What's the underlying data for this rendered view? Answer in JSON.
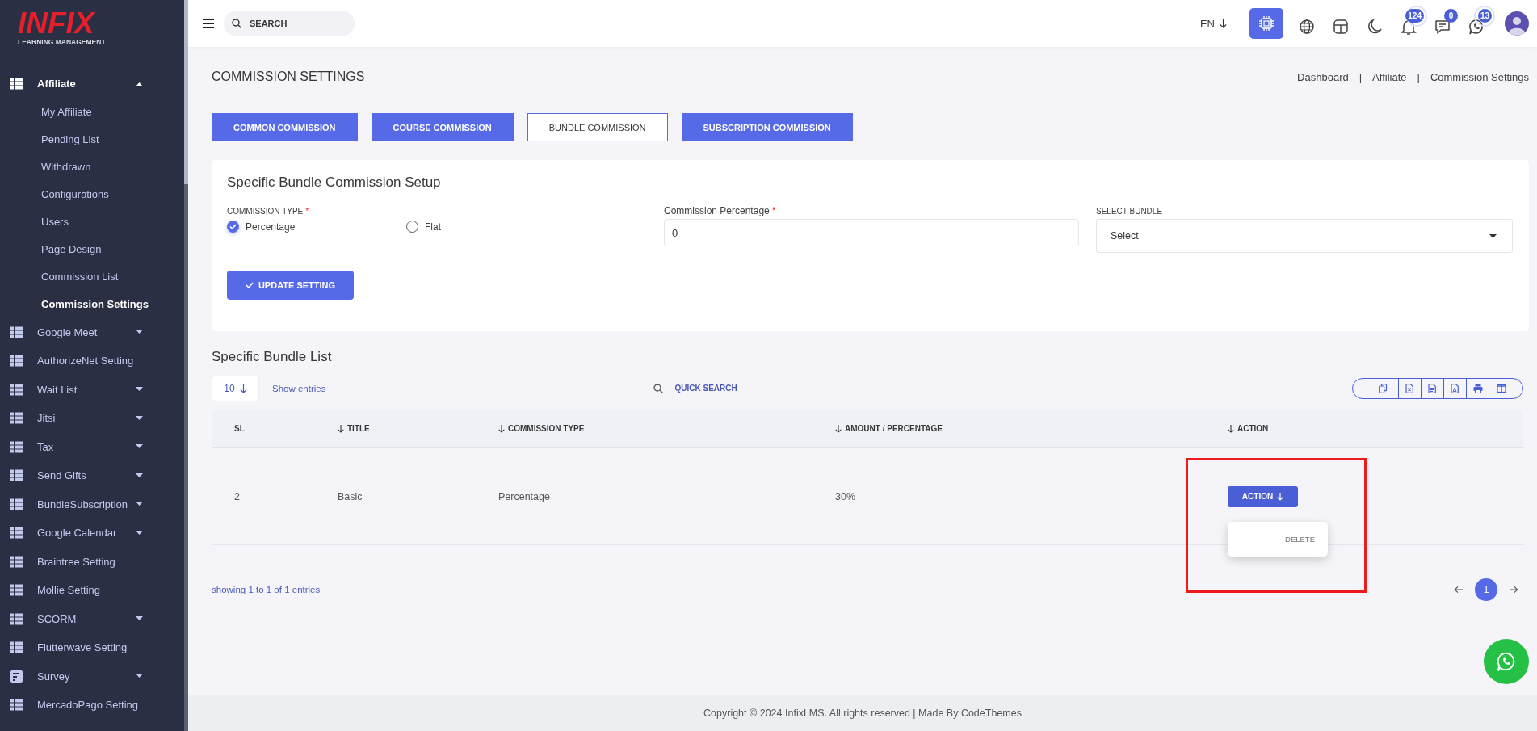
{
  "sidebar": {
    "logo": {
      "title": "INFIX",
      "subtitle": "LEARNING MANAGEMENT"
    },
    "items": [
      {
        "label": "Affiliate",
        "kind": "grid",
        "expandable": true,
        "expanded": true,
        "children": [
          {
            "label": "My Affiliate",
            "selected": false
          },
          {
            "label": "Pending List",
            "selected": false
          },
          {
            "label": "Withdrawn",
            "selected": false
          },
          {
            "label": "Configurations",
            "selected": false
          },
          {
            "label": "Users",
            "selected": false
          },
          {
            "label": "Page Design",
            "selected": false
          },
          {
            "label": "Commission List",
            "selected": false
          },
          {
            "label": "Commission Settings",
            "selected": true
          }
        ]
      },
      {
        "label": "Google Meet",
        "kind": "grid",
        "expandable": true,
        "expanded": false
      },
      {
        "label": "AuthorizeNet Setting",
        "kind": "grid",
        "expandable": false,
        "expanded": false
      },
      {
        "label": "Wait List",
        "kind": "grid",
        "expandable": true,
        "expanded": false
      },
      {
        "label": "Jitsi",
        "kind": "grid",
        "expandable": true,
        "expanded": false
      },
      {
        "label": "Tax",
        "kind": "grid",
        "expandable": true,
        "expanded": false
      },
      {
        "label": "Send Gifts",
        "kind": "grid",
        "expandable": true,
        "expanded": false
      },
      {
        "label": "BundleSubscription",
        "kind": "grid",
        "expandable": true,
        "expanded": false
      },
      {
        "label": "Google Calendar",
        "kind": "grid",
        "expandable": true,
        "expanded": false
      },
      {
        "label": "Braintree Setting",
        "kind": "grid",
        "expandable": false,
        "expanded": false
      },
      {
        "label": "Mollie Setting",
        "kind": "grid",
        "expandable": false,
        "expanded": false
      },
      {
        "label": "SCORM",
        "kind": "grid",
        "expandable": true,
        "expanded": false
      },
      {
        "label": "Flutterwave Setting",
        "kind": "grid",
        "expandable": false,
        "expanded": false
      },
      {
        "label": "Survey",
        "kind": "survey",
        "expandable": true,
        "expanded": false
      },
      {
        "label": "MercadoPago Setting",
        "kind": "grid",
        "expandable": false,
        "expanded": false
      }
    ]
  },
  "topbar": {
    "search": {
      "placeholder": "SEARCH"
    },
    "language": "EN",
    "actions": [
      {
        "kind": "chip",
        "highlighted": true
      },
      {
        "kind": "globe",
        "highlighted": false
      },
      {
        "kind": "layout",
        "highlighted": false
      },
      {
        "kind": "moon",
        "highlighted": false
      },
      {
        "kind": "bell",
        "highlighted": false,
        "badge": "124",
        "pulse": true
      },
      {
        "kind": "chat",
        "highlighted": false,
        "badge": "0",
        "pulse": false
      },
      {
        "kind": "phone-chat",
        "highlighted": false,
        "badge": "13",
        "pulse": true
      }
    ]
  },
  "page": {
    "title": "COMMISSION SETTINGS",
    "breadcrumb": [
      "Dashboard",
      "Affiliate",
      "Commission Settings"
    ],
    "separator": "|"
  },
  "tabs": [
    {
      "label": "COMMON COMMISSION",
      "selected": false
    },
    {
      "label": "COURSE COMMISSION",
      "selected": false
    },
    {
      "label": "BUNDLE COMMISSION",
      "selected": true
    },
    {
      "label": "SUBSCRIPTION COMMISSION",
      "selected": false
    }
  ],
  "setup": {
    "title": "Specific Bundle Commission Setup",
    "commission_type": {
      "label": "COMMISSION TYPE",
      "required_mark": "*",
      "options": [
        {
          "label": "Percentage",
          "checked": true
        },
        {
          "label": "Flat",
          "checked": false
        }
      ]
    },
    "percentage": {
      "label": "Commission Percentage",
      "required_mark": "*",
      "value": "0"
    },
    "bundle": {
      "label": "SELECT BUNDLE",
      "value": "Select"
    },
    "submit": "UPDATE SETTING"
  },
  "list": {
    "title": "Specific Bundle List",
    "page_size": "10",
    "show_entries": "Show entries",
    "search_placeholder": "QUICK SEARCH",
    "export_buttons": [
      {
        "kind": "copy"
      },
      {
        "kind": "excel"
      },
      {
        "kind": "csv"
      },
      {
        "kind": "pdf"
      },
      {
        "kind": "print"
      },
      {
        "kind": "columns"
      }
    ],
    "columns": [
      {
        "label": "SL",
        "sortable": false
      },
      {
        "label": "TITLE",
        "sortable": true
      },
      {
        "label": "COMMISSION TYPE",
        "sortable": true
      },
      {
        "label": "AMOUNT / PERCENTAGE",
        "sortable": true
      },
      {
        "label": "ACTION",
        "sortable": true
      }
    ],
    "rows": [
      {
        "cells": [
          "2",
          "Basic",
          "Percentage",
          "30%"
        ],
        "action": "ACTION",
        "menu_open": true,
        "menu": [
          "DELETE"
        ],
        "highlighted": true
      }
    ],
    "summary": "showing 1 to 1 of 1 entries",
    "pages": [
      {
        "label": "1",
        "selected": true
      }
    ]
  },
  "footer": "Copyright © 2024 InfixLMS. All rights reserved | Made By CodeThemes"
}
